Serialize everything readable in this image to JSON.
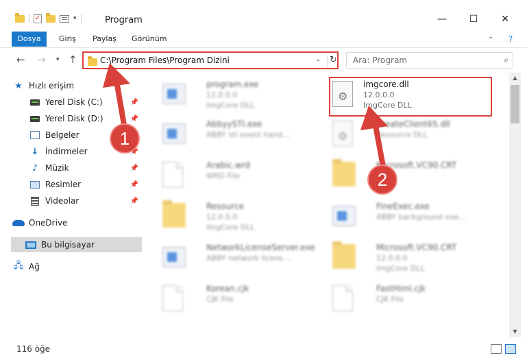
{
  "window": {
    "title": "Program"
  },
  "ribbon": {
    "tabs": [
      "Dosya",
      "Giriş",
      "Paylaş",
      "Görünüm"
    ]
  },
  "address": {
    "path": "C:\\Program Files\\Program Dizini"
  },
  "search": {
    "placeholder": "Ara: Program"
  },
  "sidebar": {
    "items": [
      {
        "label": "Hızlı erişim",
        "icon": "star-icon"
      },
      {
        "label": "Yerel Disk (C:)",
        "icon": "drive-icon",
        "pinned": true
      },
      {
        "label": "Yerel Disk (D:)",
        "icon": "drive-icon",
        "pinned": true
      },
      {
        "label": "Belgeler",
        "icon": "documents-icon",
        "pinned": true
      },
      {
        "label": "İndirmeler",
        "icon": "download-icon",
        "pinned": true
      },
      {
        "label": "Müzik",
        "icon": "music-icon",
        "pinned": true
      },
      {
        "label": "Resimler",
        "icon": "pictures-icon",
        "pinned": true
      },
      {
        "label": "Videolar",
        "icon": "videos-icon",
        "pinned": true
      },
      {
        "label": "OneDrive",
        "icon": "cloud-icon"
      },
      {
        "label": "Bu bilgisayar",
        "icon": "computer-icon",
        "selected": true
      },
      {
        "label": "Ağ",
        "icon": "network-icon"
      }
    ]
  },
  "files": [
    {
      "name": "program.exe",
      "line2": "12.0.0.0",
      "line3": "ImgCore DLL",
      "icon": "exe-icon"
    },
    {
      "name": "imgcore.dll",
      "line2": "12.0.0.0",
      "line3": "ImgCore DLL",
      "icon": "dll-gear-icon",
      "highlighted": true
    },
    {
      "name": "AbbyySTI.exe",
      "line2": "ABBY sti event hand...",
      "line3": "",
      "icon": "exe-icon"
    },
    {
      "name": "CreateClient65.dll",
      "line2": "Resource DLL",
      "line3": "",
      "icon": "dll-gear-icon"
    },
    {
      "name": "Arabic.wrd",
      "line2": "WRD File",
      "line3": "",
      "icon": "file-icon"
    },
    {
      "name": "Microsoft.VC90.CRT",
      "line2": "",
      "line3": "",
      "icon": "folder-icon"
    },
    {
      "name": "Resource",
      "line2": "12.0.0.0",
      "line3": "ImgCore DLL",
      "icon": "folder-icon"
    },
    {
      "name": "FineExec.exe",
      "line2": "ABBY background exe...",
      "line3": "",
      "icon": "exe-icon"
    },
    {
      "name": "NetworkLicenseServer.exe",
      "line2": "ABBY network licens...",
      "line3": "",
      "icon": "exe-icon"
    },
    {
      "name": "Microsoft.VC90.CRT",
      "line2": "12.0.0.0",
      "line3": "ImgCore DLL",
      "icon": "folder-icon"
    },
    {
      "name": "Korean.cjk",
      "line2": "CJK File",
      "line3": "",
      "icon": "file-icon"
    },
    {
      "name": "FastHiml.cjk",
      "line2": "CJK File",
      "line3": "",
      "icon": "file-icon"
    }
  ],
  "status": {
    "count": "116 öğe"
  },
  "annotations": {
    "badge1": "1",
    "badge2": "2",
    "color": "#d8403a"
  }
}
